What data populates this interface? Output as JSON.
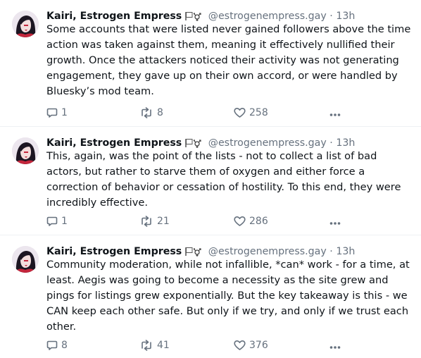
{
  "posts": [
    {
      "author": "Kairi, Estrogen Empress",
      "handle": "@estrogenempress.gay",
      "separator": "·",
      "time": "13h",
      "lines": [
        "Some accounts that were listed never gained followers above the time",
        "action was taken against them, meaning it effectively nullified their",
        "growth. Once the attackers noticed their activity was not generating",
        "engagement, they gave up on their own accord, or were handled by",
        "Bluesky’s mod team."
      ],
      "replies": "1",
      "reposts": "8",
      "likes": "258"
    },
    {
      "author": "Kairi, Estrogen Empress",
      "handle": "@estrogenempress.gay",
      "separator": "·",
      "time": "13h",
      "lines": [
        "This, again, was the point of the lists - not to collect a list of bad",
        "actors, but rather to starve them of oxygen and either force a",
        "correction of behavior or cessation of hostility. To this end, they were",
        "incredibly effective."
      ],
      "replies": "1",
      "reposts": "21",
      "likes": "286"
    },
    {
      "author": "Kairi, Estrogen Empress",
      "handle": "@estrogenempress.gay",
      "separator": "·",
      "time": "13h",
      "lines": [
        "Community moderation, while not infallible, *can* work - for a time, at",
        "least. Aegis was going to become a necessity as the site grew and",
        "pings for listings grew exponentially. But the key takeaway is this - we",
        "CAN keep each other safe. But only if we try, and only if we trust each",
        "other."
      ],
      "replies": "8",
      "reposts": "41",
      "likes": "376"
    }
  ],
  "icons": {
    "author_flags": "white-flag-and-transgender-symbol-icon",
    "reply": "speech-bubble-icon",
    "repost": "repost-arrows-icon",
    "like": "heart-outline-icon",
    "more": "ellipsis-icon"
  },
  "colors": {
    "text": "#0f1419",
    "muted": "#66717e",
    "avatar_hair": "#1c1622",
    "avatar_accent": "#c4263c"
  }
}
